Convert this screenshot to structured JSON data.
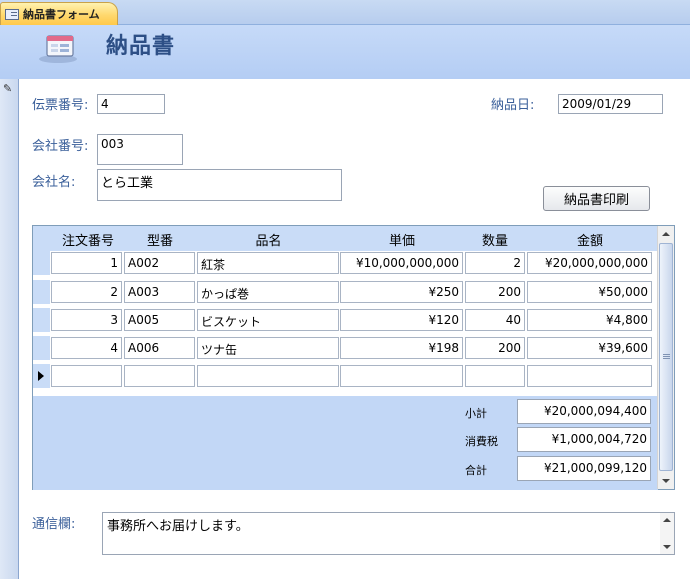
{
  "tab": {
    "label": "納品書フォーム"
  },
  "header": {
    "title": "納品書"
  },
  "form": {
    "slip_no": {
      "label": "伝票番号:",
      "value": "4"
    },
    "delivery_date": {
      "label": "納品日:",
      "value": "2009/01/29"
    },
    "company_no": {
      "label": "会社番号:",
      "value": "003"
    },
    "company_name": {
      "label": "会社名:",
      "value": "とら工業"
    },
    "print_button": "納品書印刷"
  },
  "subform": {
    "columns": [
      "注文番号",
      "型番",
      "品名",
      "単価",
      "数量",
      "金額"
    ],
    "rows": [
      {
        "order_no": "1",
        "model": "A002",
        "name": "紅茶",
        "unit_price": "¥10,000,000,000",
        "qty": "2",
        "amount": "¥20,000,000,000"
      },
      {
        "order_no": "2",
        "model": "A003",
        "name": "かっぱ巻",
        "unit_price": "¥250",
        "qty": "200",
        "amount": "¥50,000"
      },
      {
        "order_no": "3",
        "model": "A005",
        "name": "ビスケット",
        "unit_price": "¥120",
        "qty": "40",
        "amount": "¥4,800"
      },
      {
        "order_no": "4",
        "model": "A006",
        "name": "ツナ缶",
        "unit_price": "¥198",
        "qty": "200",
        "amount": "¥39,600"
      }
    ],
    "subtotal": {
      "label": "小計",
      "value": "¥20,000,094,400"
    },
    "tax": {
      "label": "消費税",
      "value": "¥1,000,004,720"
    },
    "total": {
      "label": "合計",
      "value": "¥21,000,099,120"
    }
  },
  "memo": {
    "label": "通信欄:",
    "value": "事務所へお届けします。"
  },
  "colors": {
    "header_bg": "#c6daf8",
    "title": "#2d4f86",
    "label": "#3a5f9a",
    "tab": "#ffd86e"
  }
}
